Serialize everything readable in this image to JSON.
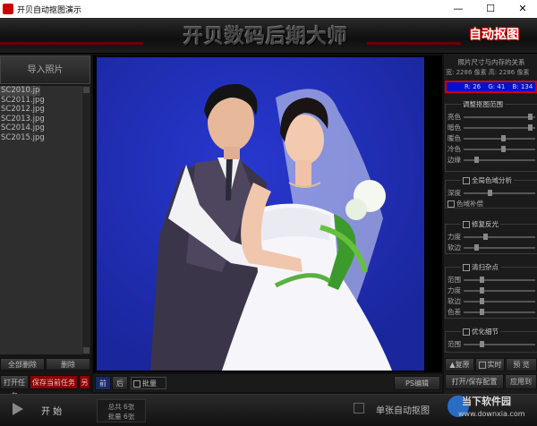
{
  "window": {
    "title": "开贝自动抠图演示",
    "controls": [
      "—",
      "☐",
      "✕"
    ]
  },
  "banner": {
    "brand": "开贝数码后期大师",
    "mode_label": "自动抠图"
  },
  "left": {
    "import_label": "导入照片",
    "files": [
      "SC2010.jpg",
      "SC2011.jpg",
      "SC2012.jpg",
      "SC2013.jpg",
      "SC2014.jpg",
      "SC2015.jpg"
    ],
    "selected_index": 0,
    "delete_all_label": "全部删除",
    "delete_label": "删除",
    "open_task_label": "打开任务",
    "save_task_label": "保存当前任务",
    "save_as_label": "另"
  },
  "right": {
    "size_title": "照片尺寸与内存的关系",
    "size_info": "宽: 2286 像素   高: 2286 像素",
    "rgb": {
      "r": "R: 26",
      "g": "G: 41",
      "b": "B: 134"
    },
    "adjust_title": "调整抠图范围",
    "adjust_rows": [
      "亮色",
      "暗色",
      "暖色",
      "冷色",
      "边缘"
    ],
    "global_title": "全局色域分析",
    "global_rows": [
      "深度"
    ],
    "color_fill": "色域补偿",
    "repair_title": "修复反光",
    "repair_rows": [
      "力度",
      "软边"
    ],
    "clean_title": "清扫杂点",
    "clean_rows": [
      "范围",
      "力度",
      "软边",
      "色差"
    ],
    "optimize_title": "优化细节",
    "optimize_rows": [
      "范围"
    ],
    "view_labels": [
      "▲复原",
      "实时",
      "预 览"
    ],
    "open_save_config": "打开/保存配置",
    "apply_label": "应用到"
  },
  "canvas_bar": {
    "front_label": "前",
    "back_label": "后",
    "batch_label": "批量",
    "ps_label": "PS编辑"
  },
  "bottom": {
    "start_label": "开  始",
    "total_label": "总共 6张",
    "batch_count_label": "批量 6张",
    "single_label": "单张自动抠图",
    "watermark_site": "当下软件园",
    "watermark_url": "www.downxia.com"
  },
  "colors": {
    "photo_bg": "#1e2db6",
    "rgb_box": "#0010d0",
    "accent_red": "#c40000"
  }
}
